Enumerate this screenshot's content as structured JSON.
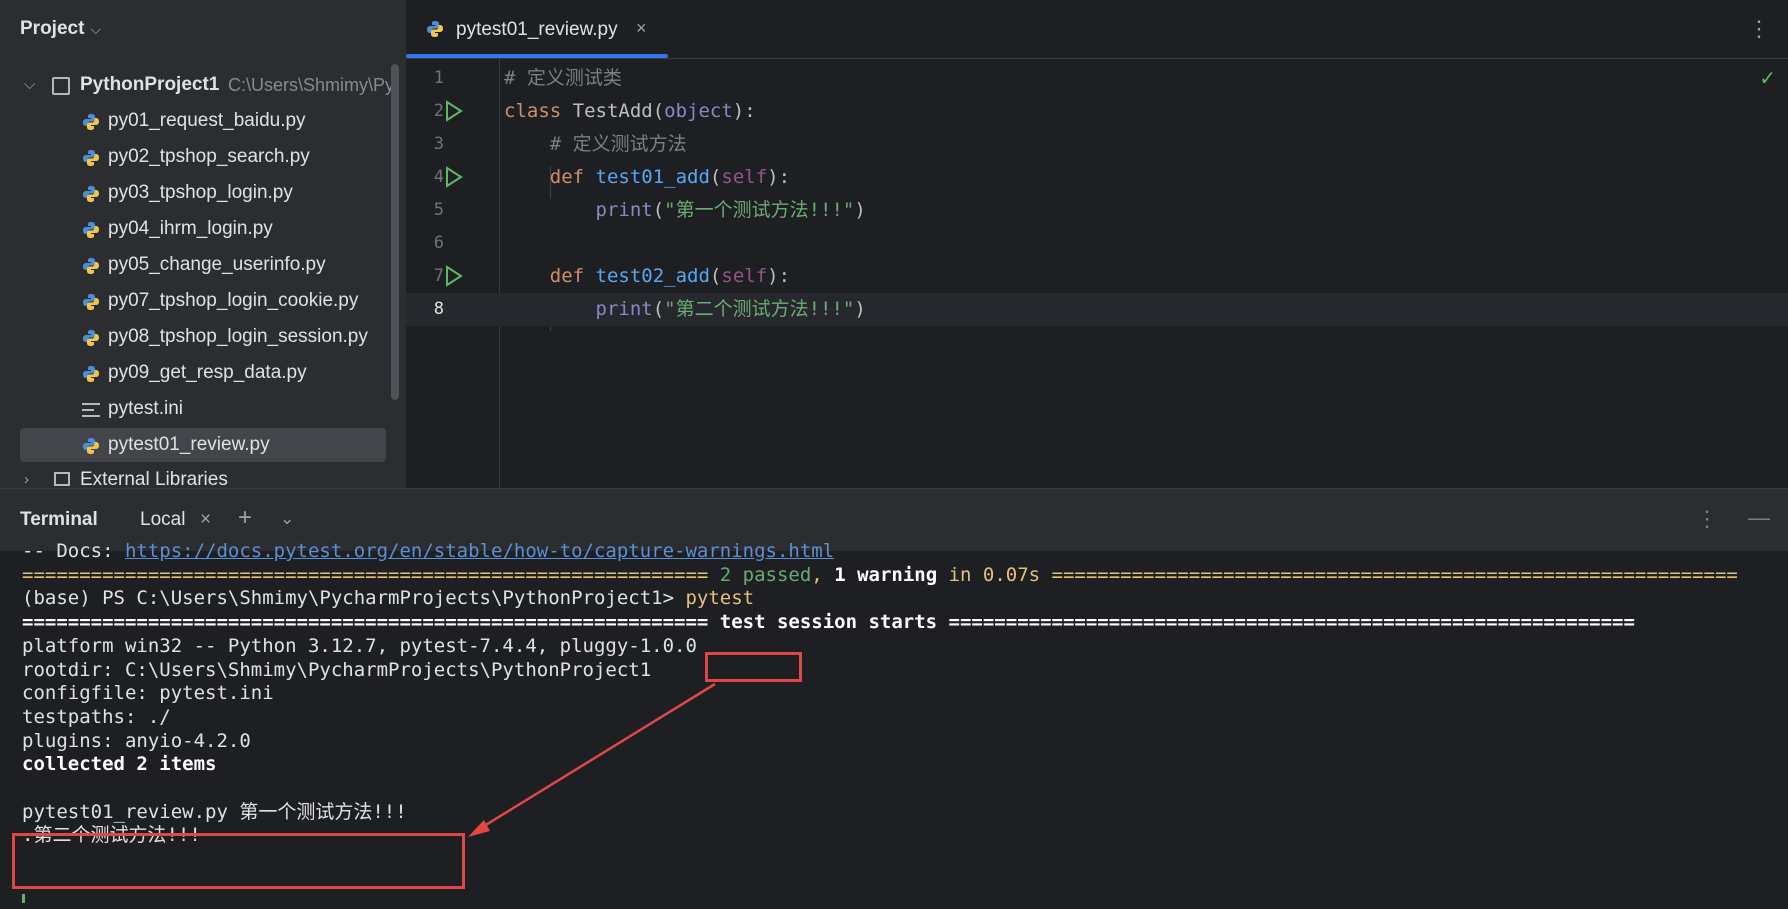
{
  "project": {
    "header": "Project",
    "root_name": "PythonProject1",
    "root_path": "C:\\Users\\Shmimy\\Py",
    "files": [
      {
        "name": "py01_request_baidu.py",
        "type": "python"
      },
      {
        "name": "py02_tpshop_search.py",
        "type": "python"
      },
      {
        "name": "py03_tpshop_login.py",
        "type": "python"
      },
      {
        "name": "py04_ihrm_login.py",
        "type": "python"
      },
      {
        "name": "py05_change_userinfo.py",
        "type": "python"
      },
      {
        "name": "py07_tpshop_login_cookie.py",
        "type": "python"
      },
      {
        "name": "py08_tpshop_login_session.py",
        "type": "python"
      },
      {
        "name": "py09_get_resp_data.py",
        "type": "python"
      },
      {
        "name": "pytest.ini",
        "type": "ini"
      },
      {
        "name": "pytest01_review.py",
        "type": "python",
        "selected": true
      }
    ],
    "external_libraries": "External Libraries"
  },
  "editor": {
    "tab_label": "pytest01_review.py",
    "close_glyph": "×",
    "more_glyph": "⋮",
    "check_glyph": "✓",
    "lines": [
      {
        "num": "1",
        "parts": [
          [
            "c-com",
            "# 定义测试类"
          ]
        ]
      },
      {
        "num": "2",
        "run": true,
        "parts": [
          [
            "c-kw",
            "class "
          ],
          [
            "c-def",
            "TestAdd("
          ],
          [
            "c-builtin",
            "object"
          ],
          [
            "c-def",
            "):"
          ]
        ]
      },
      {
        "num": "3",
        "parts": [
          [
            "c-def",
            "    "
          ],
          [
            "c-com",
            "# 定义测试方法"
          ]
        ]
      },
      {
        "num": "4",
        "run": true,
        "parts": [
          [
            "c-def",
            "    "
          ],
          [
            "c-kw",
            "def "
          ],
          [
            "c-fn",
            "test01_add"
          ],
          [
            "c-def",
            "("
          ],
          [
            "c-self",
            "self"
          ],
          [
            "c-def",
            "):"
          ]
        ]
      },
      {
        "num": "5",
        "parts": [
          [
            "c-def",
            "        "
          ],
          [
            "c-builtin",
            "print"
          ],
          [
            "c-def",
            "("
          ],
          [
            "c-str",
            "\"第一个测试方法!!!\""
          ],
          [
            "c-def",
            ")"
          ]
        ]
      },
      {
        "num": "6",
        "parts": []
      },
      {
        "num": "7",
        "run": true,
        "parts": [
          [
            "c-def",
            "    "
          ],
          [
            "c-kw",
            "def "
          ],
          [
            "c-fn",
            "test02_add"
          ],
          [
            "c-def",
            "("
          ],
          [
            "c-self",
            "self"
          ],
          [
            "c-def",
            "):"
          ]
        ]
      },
      {
        "num": "8",
        "current": true,
        "parts": [
          [
            "c-def",
            "        "
          ],
          [
            "c-builtin",
            "print"
          ],
          [
            "c-def",
            "("
          ],
          [
            "c-str",
            "\"第二个测试方法!!!\""
          ],
          [
            "c-def",
            ")"
          ]
        ]
      }
    ]
  },
  "terminal": {
    "title": "Terminal",
    "tab": "Local",
    "close_glyph": "×",
    "add_glyph": "+",
    "dropdown_glyph": "⌄",
    "kebab_glyph": "⋮",
    "minimize_glyph": "—",
    "lines": [
      [
        [
          "",
          "-- Docs: "
        ],
        [
          "t-link",
          "https://docs.pytest.org/en/stable/how-to/capture-warnings.html"
        ]
      ],
      [
        [
          "t-yel",
          "============================================================ "
        ],
        [
          "t-grn",
          "2 passed"
        ],
        [
          "t-yel",
          ", "
        ],
        [
          "t-bold t-yel",
          "1 warning"
        ],
        [
          "t-yel",
          " in 0.07s ============================================================"
        ]
      ],
      [
        [
          "",
          "(base) PS C:\\Users\\Shmimy\\PycharmProjects\\PythonProject1> "
        ],
        [
          "t-cmd",
          "pytest"
        ]
      ],
      [
        [
          "t-bold",
          "============================================================ test session starts ============================================================"
        ]
      ],
      [
        [
          "",
          "platform win32 -- Python 3.12.7, pytest-7.4.4, pluggy-1.0.0"
        ]
      ],
      [
        [
          "",
          "rootdir: C:\\Users\\Shmimy\\PycharmProjects\\PythonProject1"
        ]
      ],
      [
        [
          "",
          "configfile: pytest.ini"
        ]
      ],
      [
        [
          "",
          "testpaths: ./"
        ]
      ],
      [
        [
          "",
          "plugins: anyio-4.2.0"
        ]
      ],
      [
        [
          "t-bold",
          "collected 2 items"
        ]
      ],
      [
        [
          "",
          ""
        ]
      ],
      [
        [
          "",
          "pytest01_review.py 第一个测试方法!!!"
        ]
      ],
      [
        [
          "",
          ".第二个测试方法!!!"
        ]
      ]
    ]
  }
}
